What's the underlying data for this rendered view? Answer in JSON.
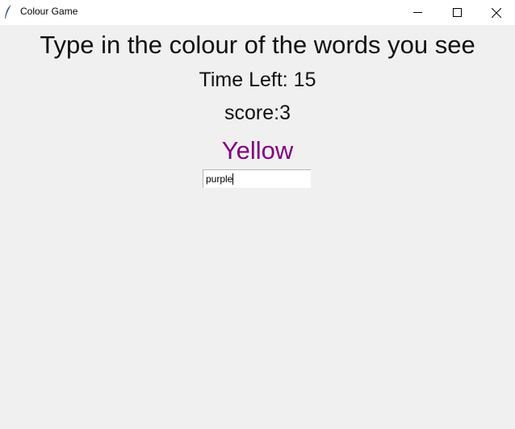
{
  "window": {
    "title": "Colour Game",
    "icon": "feather-icon"
  },
  "game": {
    "instructions": "Type in the colour of the words you see",
    "time_left": "Time Left: 15",
    "score": "score:3",
    "word": "Yellow",
    "word_color": "#800080",
    "entry_value": "purple"
  }
}
